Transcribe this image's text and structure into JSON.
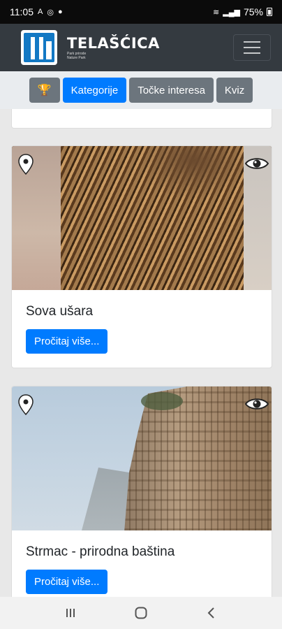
{
  "status_bar": {
    "time": "11:05",
    "indicators": "A",
    "battery": "75%"
  },
  "header": {
    "logo_title": "TELAŠĆICA",
    "logo_subtitle_line1": "Park prirode",
    "logo_subtitle_line2": "Nature Park"
  },
  "tabs": [
    {
      "label": "",
      "icon": "trophy-icon",
      "active": false
    },
    {
      "label": "Kategorije",
      "active": true
    },
    {
      "label": "Točke interesa",
      "active": false
    },
    {
      "label": "Kviz",
      "active": false
    }
  ],
  "cards": [
    {
      "title": "Sova ušara",
      "button": "Pročitaj više..."
    },
    {
      "title": "Strmac - prirodna baština",
      "button": "Pročitaj više..."
    }
  ],
  "colors": {
    "primary": "#007bff",
    "secondary": "#6c757d",
    "header_bg": "#343a40"
  }
}
